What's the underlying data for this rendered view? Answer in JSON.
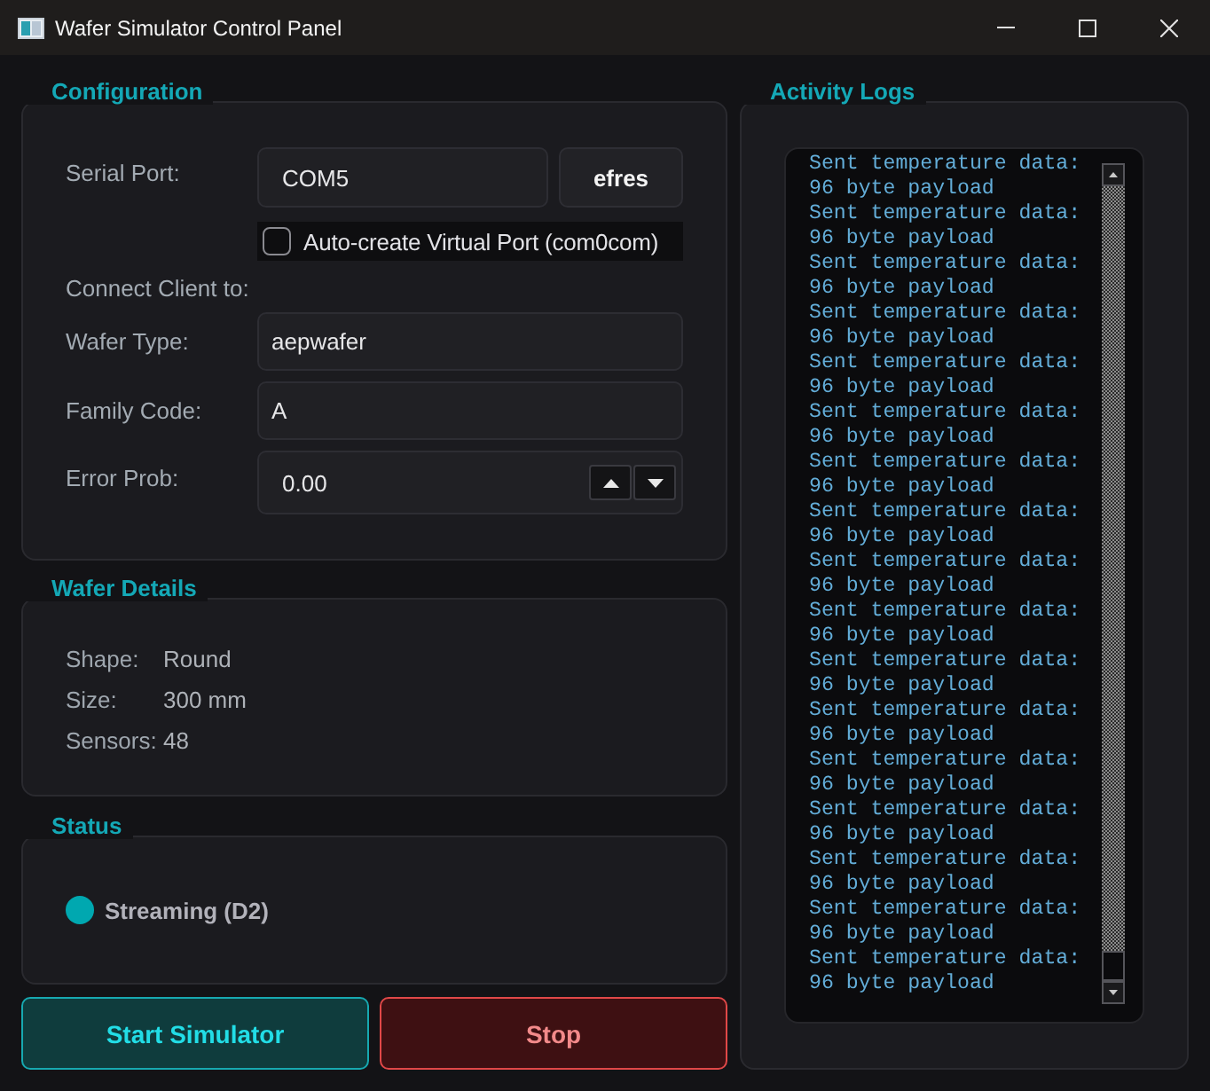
{
  "window": {
    "title": "Wafer Simulator Control Panel"
  },
  "configuration": {
    "title": "Configuration",
    "serial_port": {
      "label": "Serial Port:",
      "value": "COM5",
      "button": "efres"
    },
    "virtual_port": {
      "label": "Auto-create Virtual Port (com0com)",
      "checked": false
    },
    "connect_label": "Connect Client to:",
    "fields": [
      {
        "label": "Wafer Type:",
        "value": "aepwafer",
        "kind": "text"
      },
      {
        "label": "Family Code:",
        "value": "A",
        "kind": "text"
      },
      {
        "label": "Error Prob:",
        "value": "0.00",
        "kind": "spin"
      }
    ]
  },
  "wafer_details": {
    "title": "Wafer Details",
    "rows": [
      {
        "label": "Shape:",
        "value": "Round"
      },
      {
        "label": "Size:",
        "value": "300 mm"
      },
      {
        "label": "Sensors:",
        "value": "48"
      }
    ]
  },
  "status": {
    "title": "Status",
    "text": "Streaming (D2)",
    "color": "#00a8b0"
  },
  "buttons": [
    {
      "label": "Start Simulator",
      "kind": "start"
    },
    {
      "label": "Stop",
      "kind": "stop"
    }
  ],
  "activity_logs": {
    "title": "Activity Logs",
    "lines": [
      "Sent temperature data:",
      "96 byte payload",
      "Sent temperature data:",
      "96 byte payload",
      "Sent temperature data:",
      "96 byte payload",
      "Sent temperature data:",
      "96 byte payload",
      "Sent temperature data:",
      "96 byte payload",
      "Sent temperature data:",
      "96 byte payload",
      "Sent temperature data:",
      "96 byte payload",
      "Sent temperature data:",
      "96 byte payload",
      "Sent temperature data:",
      "96 byte payload",
      "Sent temperature data:",
      "96 byte payload",
      "Sent temperature data:",
      "96 byte payload",
      "Sent temperature data:",
      "96 byte payload",
      "Sent temperature data:",
      "96 byte payload",
      "Sent temperature data:",
      "96 byte payload",
      "Sent temperature data:",
      "96 byte payload",
      "Sent temperature data:",
      "96 byte payload",
      "Sent temperature data:",
      "96 byte payload"
    ]
  }
}
